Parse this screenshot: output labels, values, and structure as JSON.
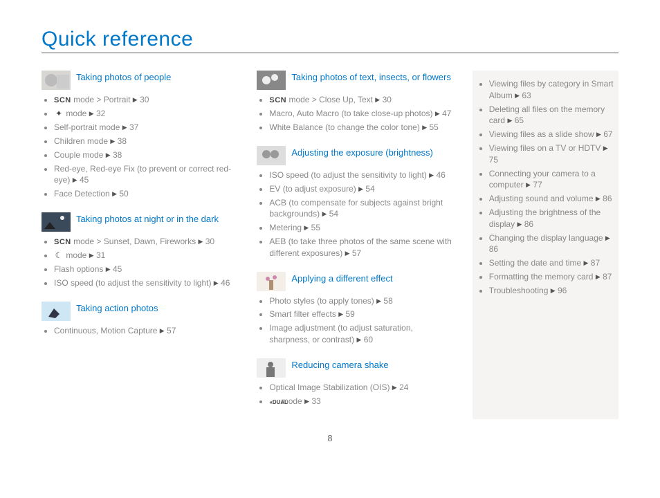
{
  "title": "Quick reference",
  "pageNumber": "8",
  "scnLabel": "SCN",
  "dualLabel": "DUAL",
  "col1": [
    {
      "heading": "Taking photos of people",
      "items": [
        {
          "scn": true,
          "text": " mode > Portrait",
          "page": "30"
        },
        {
          "icon": "✦",
          "text": " mode",
          "page": "32"
        },
        {
          "text": "Self-portrait mode",
          "page": "37"
        },
        {
          "text": "Children mode",
          "page": "38"
        },
        {
          "text": "Couple mode",
          "page": "38"
        },
        {
          "text": "Red-eye, Red-eye Fix (to prevent or correct red-eye)",
          "page": "45"
        },
        {
          "text": "Face Detection",
          "page": "50"
        }
      ]
    },
    {
      "heading": "Taking photos at night or in the dark",
      "items": [
        {
          "scn": true,
          "text": " mode > Sunset, Dawn, Fireworks",
          "page": "30"
        },
        {
          "icon": "☾",
          "text": " mode",
          "page": "31"
        },
        {
          "text": "Flash options",
          "page": "45"
        },
        {
          "text": "ISO speed (to adjust the sensitivity to light)",
          "page": "46"
        }
      ]
    },
    {
      "heading": "Taking action photos",
      "items": [
        {
          "text": "Continuous, Motion Capture",
          "page": "57"
        }
      ]
    }
  ],
  "col2": [
    {
      "heading": "Taking photos of text, insects, or flowers",
      "items": [
        {
          "scn": true,
          "text": " mode > Close Up, Text",
          "page": "30"
        },
        {
          "text": "Macro, Auto Macro (to take close-up photos)",
          "page": "47"
        },
        {
          "text": "White Balance (to change the color tone)",
          "page": "55"
        }
      ]
    },
    {
      "heading": "Adjusting the exposure (brightness)",
      "items": [
        {
          "text": "ISO speed (to adjust the sensitivity to light)",
          "page": "46"
        },
        {
          "text": "EV (to adjust exposure)",
          "page": "54"
        },
        {
          "text": "ACB (to compensate for subjects against bright backgrounds)",
          "page": "54"
        },
        {
          "text": "Metering",
          "page": "55"
        },
        {
          "text": "AEB (to take three photos of the same scene with different exposures)",
          "page": "57"
        }
      ]
    },
    {
      "heading": "Applying a different effect",
      "items": [
        {
          "text": "Photo styles (to apply tones)",
          "page": "58"
        },
        {
          "text": "Smart filter effects",
          "page": "59"
        },
        {
          "text": "Image adjustment (to adjust saturation, sharpness, or contrast)",
          "page": "60"
        }
      ]
    },
    {
      "heading": "Reducing camera shake",
      "items": [
        {
          "text": "Optical Image Stabilization (OIS)",
          "page": "24"
        },
        {
          "dual": true,
          "text": " mode",
          "page": "33"
        }
      ]
    }
  ],
  "col3": [
    {
      "text": "Viewing files by category in Smart Album",
      "page": "63"
    },
    {
      "text": "Deleting all files on the memory card",
      "page": "65"
    },
    {
      "text": "Viewing files as a slide show",
      "page": "67"
    },
    {
      "text": "Viewing files on a TV or HDTV",
      "page": "75"
    },
    {
      "text": "Connecting your camera to a computer",
      "page": "77"
    },
    {
      "text": "Adjusting sound and volume",
      "page": "86"
    },
    {
      "text": "Adjusting the brightness of the display",
      "page": "86"
    },
    {
      "text": "Changing the display language",
      "page": "86"
    },
    {
      "text": "Setting the date and time",
      "page": "87"
    },
    {
      "text": "Formatting the memory card",
      "page": "87"
    },
    {
      "text": "Troubleshooting",
      "page": "96"
    }
  ],
  "thumbs": [
    "face",
    "night",
    "action",
    "flower",
    "couple",
    "vase",
    "person"
  ]
}
